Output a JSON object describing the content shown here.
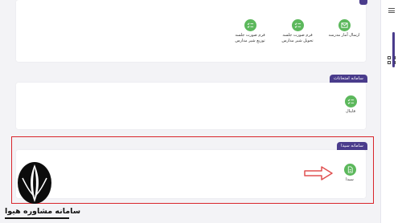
{
  "section1": {
    "tiles": [
      {
        "label_line1": "ارسال آمار مدرسه",
        "label_line2": "",
        "icon": "mail-icon"
      },
      {
        "label_line1": "فرم صورت جلسه",
        "label_line2": "تحویل شیر مدارس",
        "icon": "checklist-icon"
      },
      {
        "label_line1": "فرم صورت جلسه",
        "label_line2": "توزیع شیر مدارس",
        "icon": "checklist-icon"
      }
    ]
  },
  "section2": {
    "tab": "سامانه امتحانات",
    "tiles": [
      {
        "label": "فاینال",
        "icon": "checklist-icon"
      }
    ]
  },
  "section3": {
    "tab": "سامانه سیدا",
    "tiles": [
      {
        "label": "سیدا",
        "icon": "document-icon"
      }
    ]
  },
  "watermark": {
    "text": "سامانه مشاوره هیوا"
  },
  "colors": {
    "accent": "#4a3c8c",
    "icon_green": "#5cb85c",
    "highlight_red": "#d9252b",
    "arrow_red": "#e05050"
  }
}
